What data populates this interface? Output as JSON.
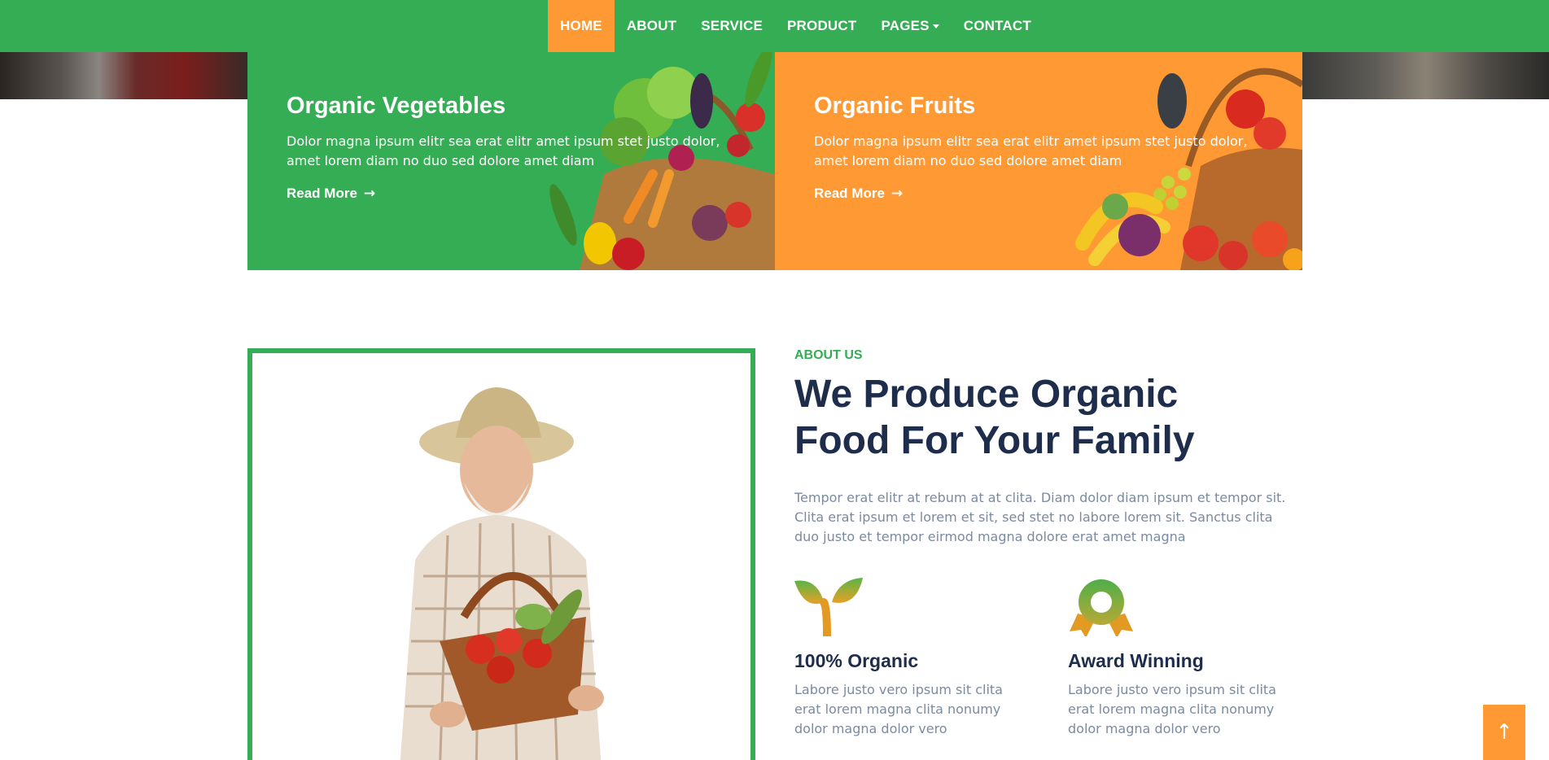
{
  "nav": {
    "items": [
      {
        "label": "HOME"
      },
      {
        "label": "ABOUT"
      },
      {
        "label": "SERVICE"
      },
      {
        "label": "PRODUCT"
      },
      {
        "label": "PAGES"
      },
      {
        "label": "CONTACT"
      }
    ],
    "active_index": 0
  },
  "promos": [
    {
      "title": "Organic Vegetables",
      "text": "Dolor magna ipsum elitr sea erat elitr amet ipsum stet justo dolor, amet lorem diam no duo sed dolore amet diam",
      "link": "Read More",
      "icon": "arrow-right-icon"
    },
    {
      "title": "Organic Fruits",
      "text": "Dolor magna ipsum elitr sea erat elitr amet ipsum stet justo dolor, amet lorem diam no duo sed dolore amet diam",
      "link": "Read More",
      "icon": "arrow-right-icon"
    }
  ],
  "about": {
    "subtitle": "ABOUT US",
    "title": "We Produce Organic Food For Your Family",
    "text": "Tempor erat elitr at rebum at at clita. Diam dolor diam ipsum et tempor sit. Clita erat ipsum et lorem et sit, sed stet no labore lorem sit. Sanctus clita duo justo et tempor eirmod magna dolore erat amet magna",
    "features": [
      {
        "icon": "sprout-icon",
        "title": "100% Organic",
        "text": "Labore justo vero ipsum sit clita erat lorem magna clita nonumy dolor magna dolor vero"
      },
      {
        "icon": "award-icon",
        "title": "Award Winning",
        "text": "Labore justo vero ipsum sit clita erat lorem magna clita nonumy dolor magna dolor vero"
      }
    ]
  },
  "back_to_top": {
    "icon": "arrow-up-icon",
    "label": "↑"
  },
  "colors": {
    "primary_green": "#34ad54",
    "accent_orange": "#ff9933",
    "heading_navy": "#1f2d4d",
    "body_gray": "#7c8aa0"
  }
}
